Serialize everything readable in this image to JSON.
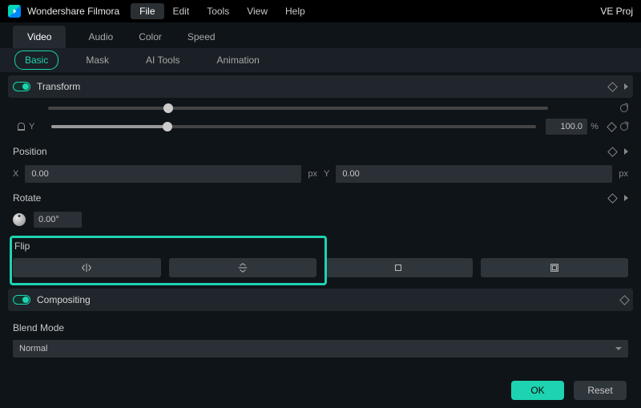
{
  "app": {
    "name": "Wondershare Filmora",
    "project": "VE Proj"
  },
  "menu": {
    "items": [
      "File",
      "Edit",
      "Tools",
      "View",
      "Help"
    ],
    "active": "File"
  },
  "topTabs": {
    "items": [
      "Video",
      "Audio",
      "Color",
      "Speed"
    ],
    "active": "Video"
  },
  "subTabs": {
    "items": [
      "Basic",
      "Mask",
      "AI Tools",
      "Animation"
    ],
    "active": "Basic"
  },
  "transform": {
    "title": "Transform",
    "scale": {
      "y_label": "Y",
      "y_value": "100.0",
      "unit": "%",
      "y_pct": 24
    },
    "position": {
      "label": "Position",
      "x_label": "X",
      "y_label": "Y",
      "x": "0.00",
      "y": "0.00",
      "unit": "px"
    },
    "rotate": {
      "label": "Rotate",
      "value": "0.00°"
    },
    "flip": {
      "label": "Flip"
    }
  },
  "compositing": {
    "title": "Compositing"
  },
  "blendMode": {
    "label": "Blend Mode",
    "value": "Normal"
  },
  "footer": {
    "ok": "OK",
    "reset": "Reset"
  }
}
